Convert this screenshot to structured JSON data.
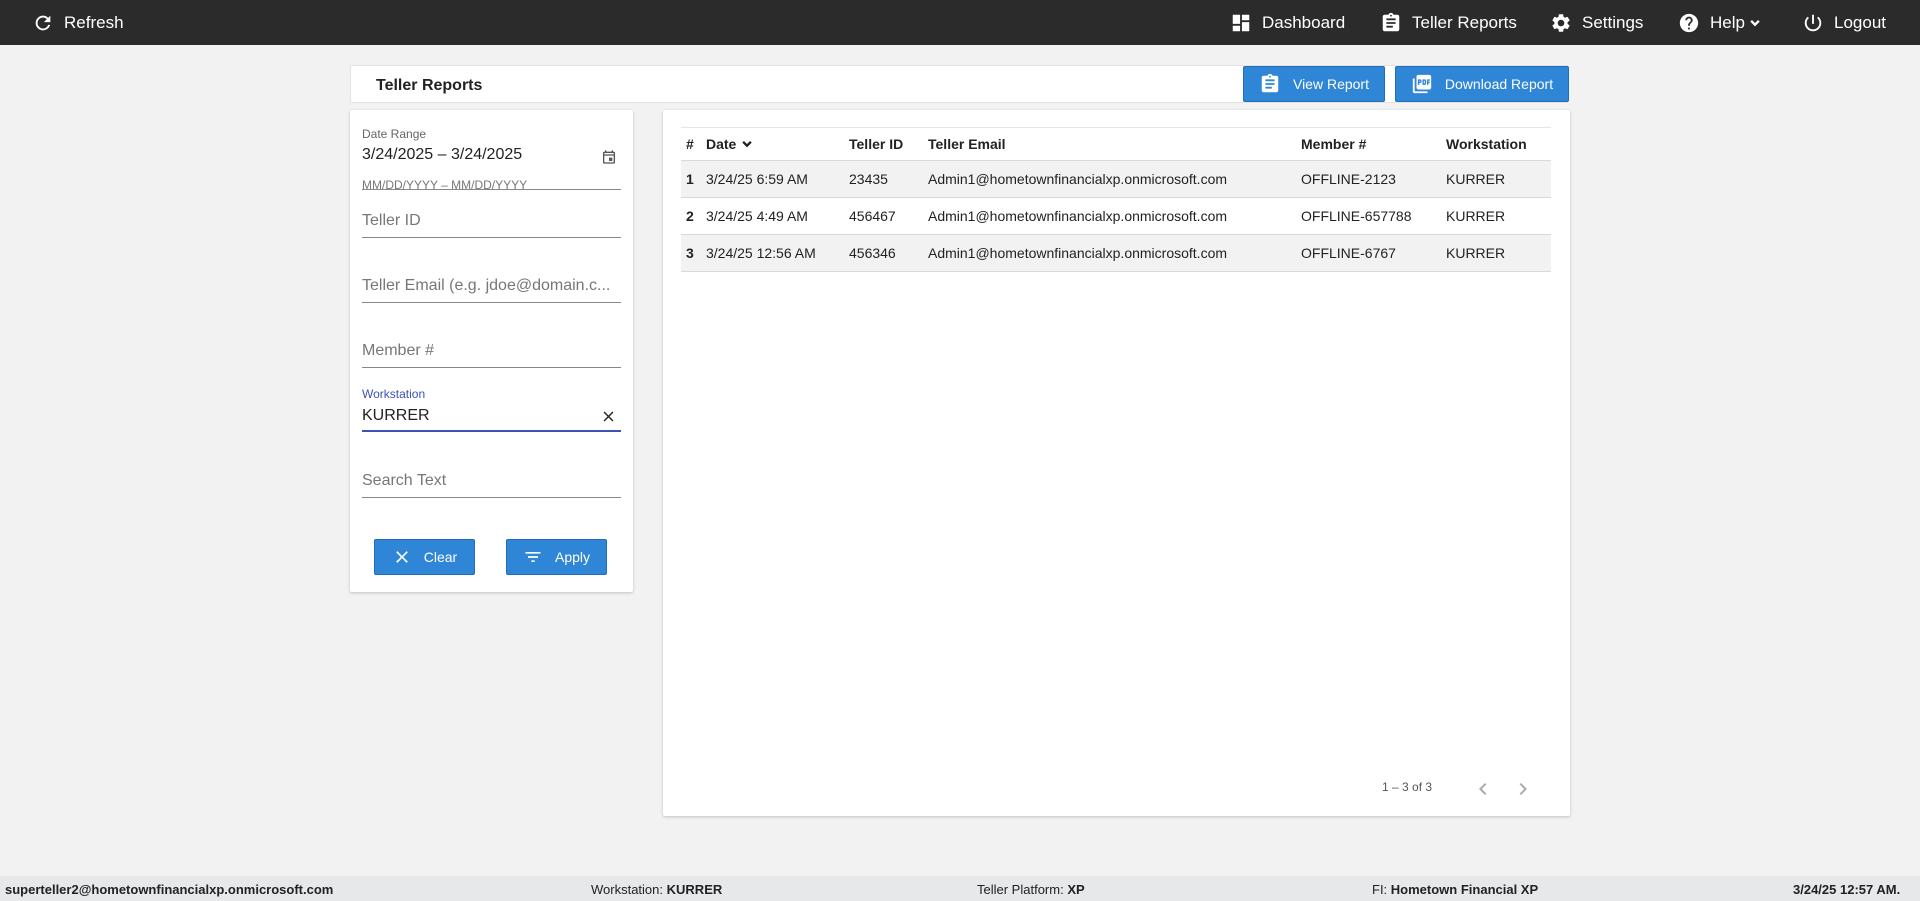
{
  "nav": {
    "refresh": "Refresh",
    "dashboard": "Dashboard",
    "teller_reports": "Teller Reports",
    "settings": "Settings",
    "help": "Help",
    "logout": "Logout"
  },
  "header": {
    "title": "Teller Reports",
    "view_report": "View Report",
    "download_report": "Download Report"
  },
  "filters": {
    "date_range_label": "Date Range",
    "date_range_value": "3/24/2025 – 3/24/2025",
    "date_hint": "MM/DD/YYYY – MM/DD/YYYY",
    "teller_id_placeholder": "Teller ID",
    "teller_email_placeholder": "Teller Email (e.g. jdoe@domain.c...",
    "member_placeholder": "Member #",
    "workstation_label": "Workstation",
    "workstation_value": "KURRER",
    "search_placeholder": "Search Text",
    "clear": "Clear",
    "apply": "Apply"
  },
  "table": {
    "headers": {
      "num": "#",
      "date": "Date",
      "teller_id": "Teller ID",
      "teller_email": "Teller Email",
      "member": "Member #",
      "workstation": "Workstation"
    },
    "rows": [
      {
        "num": "1",
        "date": "3/24/25 6:59 AM",
        "teller_id": "23435",
        "email": "Admin1@hometownfinancialxp.onmicrosoft.com",
        "member": "OFFLINE-2123",
        "workstation": "KURRER"
      },
      {
        "num": "2",
        "date": "3/24/25 4:49 AM",
        "teller_id": "456467",
        "email": "Admin1@hometownfinancialxp.onmicrosoft.com",
        "member": "OFFLINE-657788",
        "workstation": "KURRER"
      },
      {
        "num": "3",
        "date": "3/24/25 12:56 AM",
        "teller_id": "456346",
        "email": "Admin1@hometownfinancialxp.onmicrosoft.com",
        "member": "OFFLINE-6767",
        "workstation": "KURRER"
      }
    ],
    "pager": "1 – 3 of 3"
  },
  "footer": {
    "user": "superteller2@hometownfinancialxp.onmicrosoft.com",
    "workstation_label": "Workstation:",
    "workstation_value": "KURRER",
    "platform_label": "Teller Platform:",
    "platform_value": "XP",
    "fi_label": "FI:",
    "fi_value": "Hometown Financial XP",
    "datetime": "3/24/25 12:57 AM."
  },
  "colors": {
    "topbar": "#2b2b2b",
    "accent": "#2f86d6",
    "focus": "#3f51b5"
  }
}
